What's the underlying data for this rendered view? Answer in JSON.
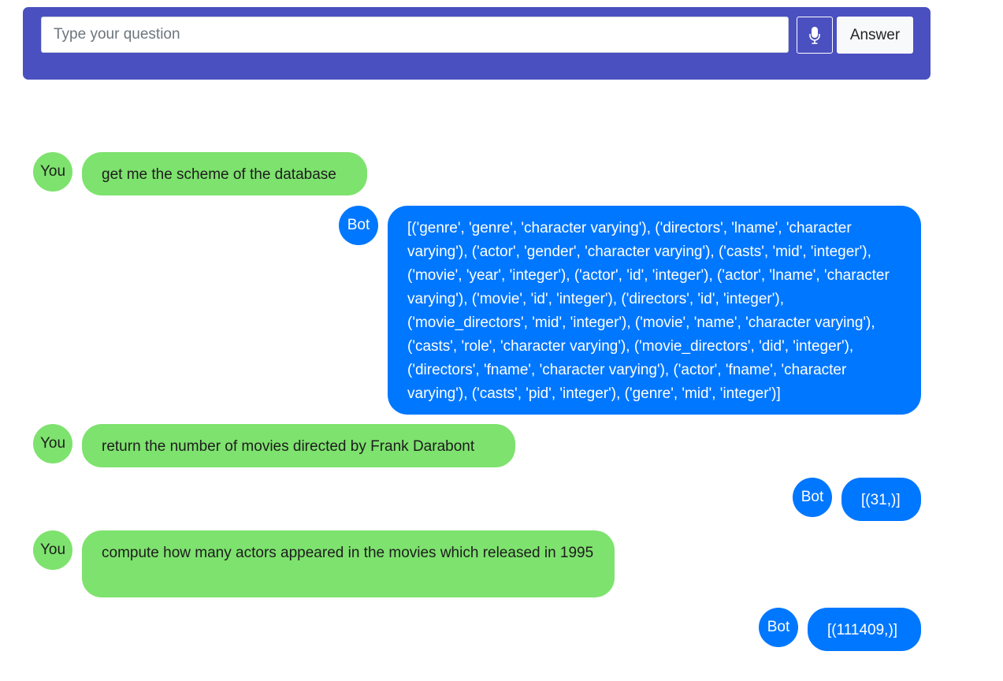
{
  "search": {
    "placeholder": "Type your question",
    "answer_label": "Answer"
  },
  "icons": {
    "mic": "microphone-icon"
  },
  "colors": {
    "header": "#4a50bf",
    "user_bubble": "#7ee26e",
    "bot_bubble": "#0077ff"
  },
  "messages": [
    {
      "sender": "You",
      "text": "get me the scheme of the database"
    },
    {
      "sender": "Bot",
      "text": "[('genre', 'genre', 'character varying'), ('directors', 'lname', 'character varying'), ('actor', 'gender', 'character varying'), ('casts', 'mid', 'integer'), ('movie', 'year', 'integer'), ('actor', 'id', 'integer'), ('actor', 'lname', 'character varying'), ('movie', 'id', 'integer'), ('directors', 'id', 'integer'), ('movie_directors', 'mid', 'integer'), ('movie', 'name', 'character varying'), ('casts', 'role', 'character varying'), ('movie_directors', 'did', 'integer'), ('directors', 'fname', 'character varying'), ('actor', 'fname', 'character varying'), ('casts', 'pid', 'integer'), ('genre', 'mid', 'integer')]"
    },
    {
      "sender": "You",
      "text": "return the number of movies directed by Frank Darabont"
    },
    {
      "sender": "Bot",
      "text": "[(31,)]"
    },
    {
      "sender": "You",
      "text": "compute how many actors appeared in the movies which released in 1995"
    },
    {
      "sender": "Bot",
      "text": "[(111409,)]"
    }
  ]
}
